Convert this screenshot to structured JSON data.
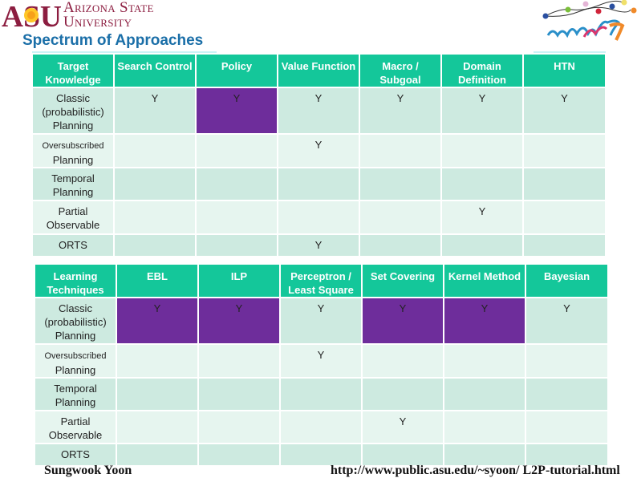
{
  "header": {
    "logo_text_line1": "Arizona State",
    "logo_text_line2": "University",
    "logo_mark": "ASU",
    "slide_title": "Spectrum of Approaches",
    "conference_logo": "icaps07"
  },
  "colors": {
    "header_green": "#14c79a",
    "row_dark": "#cdeae0",
    "row_light": "#e6f5ef",
    "highlight_purple": "#6e2d9b",
    "title_blue": "#1b6fa8",
    "asu_maroon": "#8c1d40",
    "y_blue": "#3bb4d9"
  },
  "table1": {
    "headers": [
      "Target Knowledge",
      "Search Control",
      "Policy",
      "Value Function",
      "Macro / Subgoal",
      "Domain Definition",
      "HTN"
    ],
    "rows": [
      {
        "label": "Classic (probabilistic) Planning",
        "cells": [
          "Y",
          "Y",
          "Y",
          "Y",
          "Y",
          "Y"
        ],
        "highlighted": [
          false,
          true,
          false,
          false,
          false,
          false
        ]
      },
      {
        "label_small": "Oversubscribed",
        "label": "Planning",
        "cells": [
          "",
          "",
          "Y",
          "",
          "",
          ""
        ],
        "highlighted": [
          false,
          false,
          false,
          false,
          false,
          false
        ]
      },
      {
        "label": "Temporal Planning",
        "cells": [
          "",
          "",
          "",
          "",
          "",
          ""
        ],
        "highlighted": [
          false,
          false,
          false,
          false,
          false,
          false
        ]
      },
      {
        "label": "Partial Observable",
        "cells": [
          "",
          "",
          "",
          "",
          "Y",
          ""
        ],
        "highlighted": [
          false,
          false,
          false,
          false,
          false,
          false
        ]
      },
      {
        "label": "ORTS",
        "cells": [
          "",
          "",
          "Y",
          "",
          "",
          ""
        ],
        "highlighted": [
          false,
          false,
          false,
          false,
          false,
          false
        ]
      }
    ]
  },
  "table2": {
    "headers": [
      "Learning Techniques",
      "EBL",
      "ILP",
      "Perceptron / Least Square",
      "Set Covering",
      "Kernel Method",
      "Bayesian"
    ],
    "rows": [
      {
        "label": "Classic (probabilistic) Planning",
        "cells": [
          "Y",
          "Y",
          "Y",
          "Y",
          "Y",
          "Y"
        ],
        "highlighted": [
          true,
          true,
          false,
          true,
          true,
          false
        ]
      },
      {
        "label_small": "Oversubscribed",
        "label": "Planning",
        "cells": [
          "",
          "",
          "Y",
          "",
          "",
          ""
        ],
        "highlighted": [
          false,
          false,
          false,
          false,
          false,
          false
        ]
      },
      {
        "label": "Temporal Planning",
        "cells": [
          "",
          "",
          "",
          "",
          "",
          ""
        ],
        "highlighted": [
          false,
          false,
          false,
          false,
          false,
          false
        ]
      },
      {
        "label": "Partial Observable",
        "cells": [
          "",
          "",
          "",
          "Y",
          "",
          ""
        ],
        "highlighted": [
          false,
          false,
          false,
          false,
          false,
          false
        ]
      },
      {
        "label": "ORTS",
        "cells": [
          "",
          "",
          "",
          "",
          "",
          ""
        ],
        "highlighted": [
          false,
          false,
          false,
          false,
          false,
          false
        ]
      }
    ]
  },
  "footer": {
    "author": "Sungwook Yoon",
    "url": "http://www.public.asu.edu/~syoon/ L2P-tutorial.html"
  }
}
